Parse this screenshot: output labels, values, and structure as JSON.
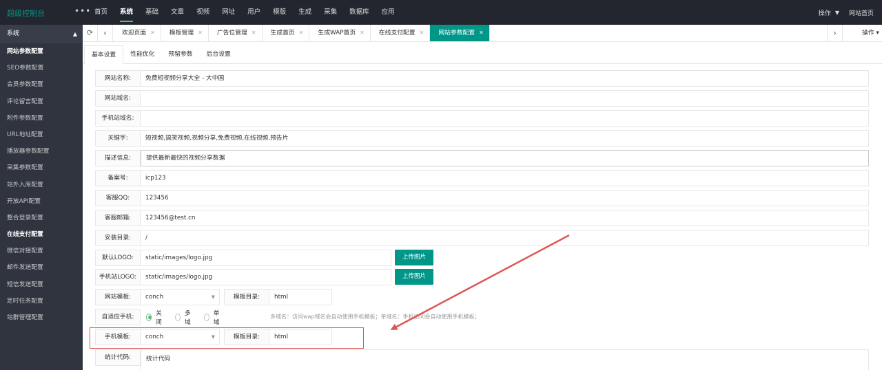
{
  "brand": "超级控制台",
  "top_nav": [
    "首页",
    "系统",
    "基础",
    "文章",
    "视频",
    "网址",
    "用户",
    "模版",
    "生成",
    "采集",
    "数据库",
    "应用"
  ],
  "top_nav_active": 1,
  "top_right": {
    "ops": "操作",
    "home": "网站首页"
  },
  "sidebar": {
    "header": "系统",
    "items": [
      "网站参数配置",
      "SEO参数配置",
      "会员参数配置",
      "评论留言配置",
      "附件参数配置",
      "URL地址配置",
      "播放器参数配置",
      "采集参数配置",
      "站外入库配置",
      "开放API配置",
      "整合登录配置",
      "在线支付配置",
      "微信对接配置",
      "邮件发送配置",
      "短信发送配置",
      "定时任务配置",
      "站群管理配置"
    ],
    "active": [
      0,
      11
    ]
  },
  "tabs": {
    "items": [
      "欢迎页面",
      "模板管理",
      "广告位管理",
      "生成首页",
      "生成WAP首页",
      "在线支付配置",
      "网站参数配置"
    ],
    "active": 6,
    "ops": "操作"
  },
  "subtabs": {
    "items": [
      "基本设置",
      "性能优化",
      "预留参数",
      "后台设置"
    ],
    "active": 0
  },
  "form": {
    "site_name": {
      "label": "网站名称:",
      "value": "免费短视频分享大全 - 大中国"
    },
    "site_domain": {
      "label": "网站域名:",
      "value": ""
    },
    "mobile_domain": {
      "label": "手机站域名:",
      "value": ""
    },
    "keywords": {
      "label": "关键字:",
      "value": "短视频,搞笑视频,视频分享,免费视频,在线视频,预告片"
    },
    "description": {
      "label": "描述信息:",
      "value": "提供最新最快的视频分享数据"
    },
    "icp": {
      "label": "备案号:",
      "value": "icp123"
    },
    "qq": {
      "label": "客服QQ:",
      "value": "123456"
    },
    "email": {
      "label": "客服邮箱:",
      "value": "123456@test.cn"
    },
    "install_dir": {
      "label": "安装目录:",
      "value": "/"
    },
    "logo": {
      "label": "默认LOGO:",
      "value": "static/images/logo.jpg",
      "button": "上传图片"
    },
    "mobile_logo": {
      "label": "手机站LOGO:",
      "value": "static/images/logo.jpg",
      "button": "上传图片"
    },
    "template": {
      "label": "网站模板:",
      "value": "conch",
      "dir_label": "模板目录:",
      "dir_value": "html"
    },
    "adaptive": {
      "label": "自适应手机:",
      "options": [
        "关闭",
        "多域",
        "单域"
      ],
      "selected": 0,
      "tip": "多域名：访问wap域名会自动使用手机模板；单域名：手机访问会自动使用手机模板；"
    },
    "mobile_template": {
      "label": "手机模板:",
      "value": "conch",
      "dir_label": "模板目录:",
      "dir_value": "html"
    },
    "stats_code": {
      "label": "统计代码:",
      "value": "统计代码"
    }
  },
  "colors": {
    "accent": "#009688",
    "topbar": "#23262e",
    "sidebar": "#2f343e",
    "annotation": "#e05555"
  }
}
